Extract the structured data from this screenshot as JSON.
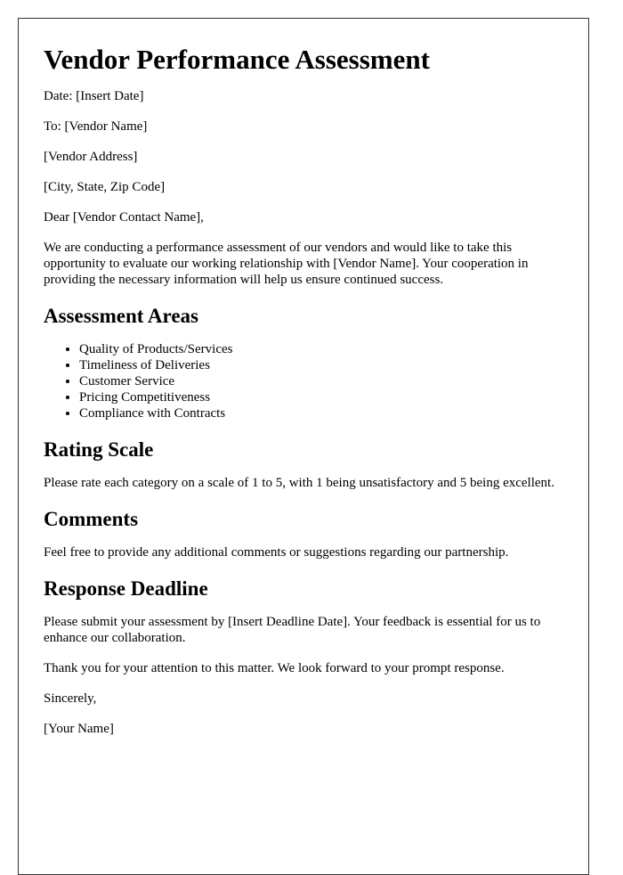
{
  "title": "Vendor Performance Assessment",
  "header": {
    "date": "Date: [Insert Date]",
    "to": "To: [Vendor Name]",
    "address": "[Vendor Address]",
    "city": "[City, State, Zip Code]",
    "salutation": "Dear [Vendor Contact Name],"
  },
  "intro": "We are conducting a performance assessment of our vendors and would like to take this opportunity to evaluate our working relationship with [Vendor Name]. Your cooperation in providing the necessary information will help us ensure continued success.",
  "sections": {
    "areas": {
      "heading": "Assessment Areas",
      "items": [
        "Quality of Products/Services",
        "Timeliness of Deliveries",
        "Customer Service",
        "Pricing Competitiveness",
        "Compliance with Contracts"
      ]
    },
    "rating": {
      "heading": "Rating Scale",
      "text": "Please rate each category on a scale of 1 to 5, with 1 being unsatisfactory and 5 being excellent."
    },
    "comments": {
      "heading": "Comments",
      "text": "Feel free to provide any additional comments or suggestions regarding our partnership."
    },
    "deadline": {
      "heading": "Response Deadline",
      "text": "Please submit your assessment by [Insert Deadline Date]. Your feedback is essential for us to enhance our collaboration."
    }
  },
  "closing": {
    "thanks": "Thank you for your attention to this matter. We look forward to your prompt response.",
    "signoff": "Sincerely,",
    "name": "[Your Name]"
  }
}
